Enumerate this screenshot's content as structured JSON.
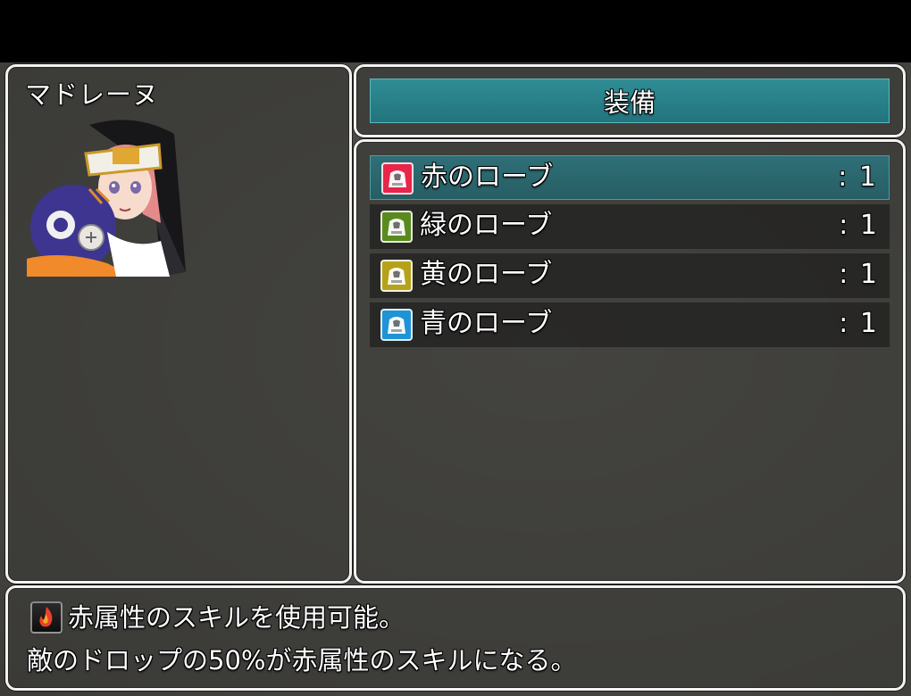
{
  "actor": {
    "name": "マドレーヌ",
    "portrait_icon": "nun-character-portrait"
  },
  "command": {
    "label": "装備"
  },
  "items": [
    {
      "name": "赤のローブ",
      "count": ":  1",
      "icon": "red-robe-icon",
      "color": "#e8254a",
      "selected": true
    },
    {
      "name": "緑のローブ",
      "count": ":  1",
      "icon": "green-robe-icon",
      "color": "#5a8a1e",
      "selected": false
    },
    {
      "name": "黄のローブ",
      "count": ":  1",
      "icon": "yellow-robe-icon",
      "color": "#b6a21a",
      "selected": false
    },
    {
      "name": "青のローブ",
      "count": ":  1",
      "icon": "blue-robe-icon",
      "color": "#1f93d6",
      "selected": false
    }
  ],
  "help": {
    "icon": "fire-element-icon",
    "line1": "赤属性のスキルを使用可能。",
    "line2": "敵のドロップの50%が赤属性のスキルになる。"
  },
  "colors": {
    "selection": "#2f8d95",
    "window_border": "#f2f2f2"
  }
}
